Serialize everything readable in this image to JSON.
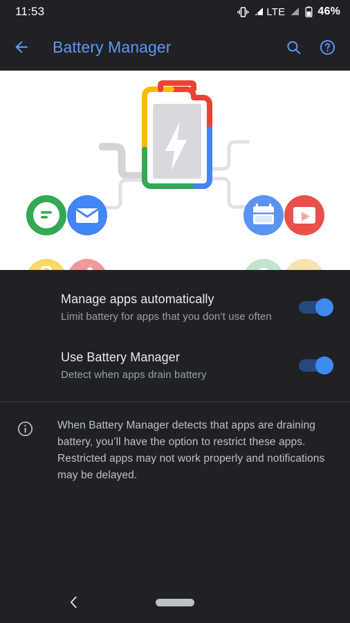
{
  "status_bar": {
    "time": "11:53",
    "battery_percent": "46%",
    "icons": [
      "vibrate-icon",
      "signal-no-sim-icon",
      "lte-label",
      "signal-bars-icon",
      "battery-icon"
    ],
    "network_label": "LTE"
  },
  "app_bar": {
    "back_icon": "arrow-back-icon",
    "title": "Battery Manager",
    "search_icon": "search-icon",
    "help_icon": "help-circle-icon",
    "accent_color": "#5e97f6"
  },
  "illustration": {
    "name": "battery-manager-hero-illustration",
    "background": "#ffffff",
    "battery": {
      "border_colors": {
        "top": "#ea4335",
        "left_upper": "#fbbc04",
        "left_lower": "#34a853",
        "right_lower": "#4285f4"
      },
      "fill": "#d7d9dd",
      "bolt_color": "#ffffff"
    },
    "app_icons": [
      {
        "name": "messages-icon",
        "circle": "#34a853",
        "glyph": "chat-bubble",
        "position": "left-top-1"
      },
      {
        "name": "email-icon",
        "circle": "#4285f4",
        "glyph": "envelope",
        "position": "left-top-2"
      },
      {
        "name": "briefcase-icon",
        "circle": "#fcd667",
        "glyph": "briefcase",
        "position": "left-bottom-1"
      },
      {
        "name": "fitness-icon",
        "circle": "#ef9a9a",
        "glyph": "running-person",
        "position": "left-bottom-2"
      },
      {
        "name": "calendar-icon",
        "circle": "#5b93f0",
        "glyph": "calendar",
        "position": "right-top-1"
      },
      {
        "name": "video-player-icon",
        "circle": "#e8504a",
        "glyph": "play-rectangle",
        "position": "right-top-2"
      },
      {
        "name": "maps-icon",
        "circle": "#c2e3cc",
        "glyph": "location-pin",
        "position": "right-bottom-1"
      },
      {
        "name": "camera-icon",
        "circle": "#f7e2b0",
        "glyph": "video-camera",
        "position": "right-bottom-2"
      }
    ],
    "connector_color": "#d2d4d8"
  },
  "preferences": [
    {
      "name": "manage-apps-automatically",
      "title": "Manage apps automatically",
      "summary": "Limit battery for apps that you don’t use often",
      "toggle_state": "on"
    },
    {
      "name": "use-battery-manager",
      "title": "Use Battery Manager",
      "summary": "Detect when apps drain battery",
      "toggle_state": "on"
    }
  ],
  "footer": {
    "icon": "info-circle-icon",
    "text": "When Battery Manager detects that apps are draining battery, you’ll have the option to restrict these apps. Restricted apps may not work properly and notifications may be delayed."
  },
  "nav_bar": {
    "back_icon": "chevron-back-icon",
    "home_pill": "home-gesture-pill"
  },
  "colors": {
    "background": "#202124",
    "accent": "#5e97f6",
    "toggle_on": "#3d8bf2",
    "toggle_track": "#27487d",
    "primary_text": "#e8eaed",
    "secondary_text": "#9aa0a6"
  }
}
